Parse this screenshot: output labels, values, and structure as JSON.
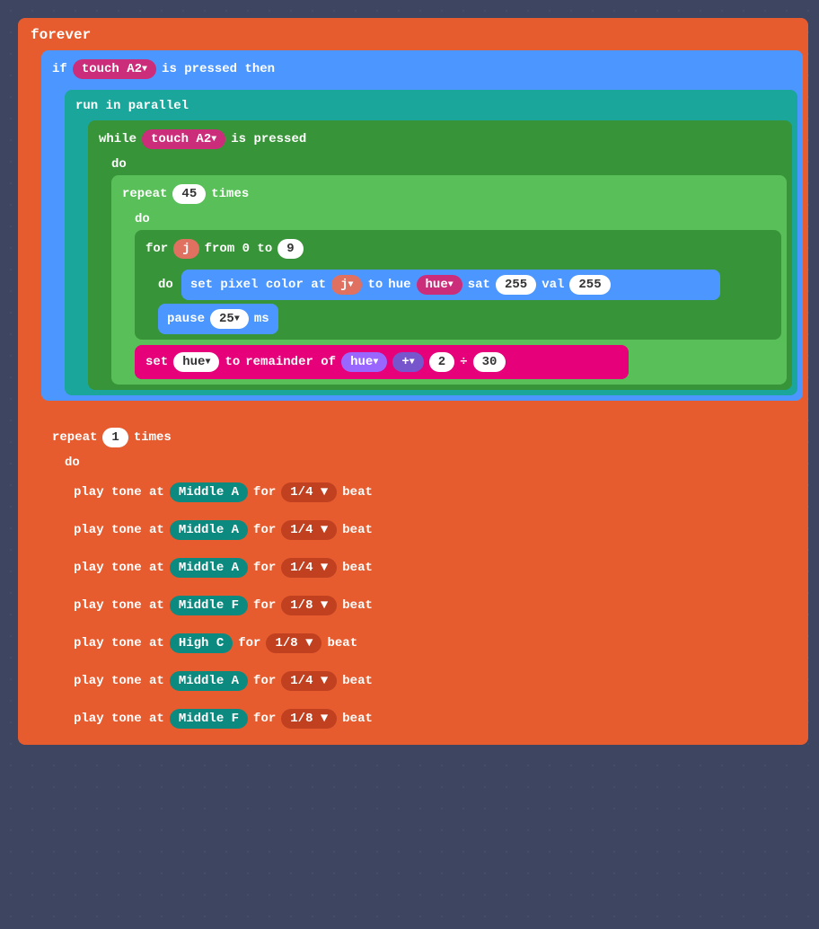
{
  "forever": {
    "label": "forever"
  },
  "if_block": {
    "label": "if",
    "condition_pill": "touch A2",
    "middle": "is pressed then"
  },
  "run_in_parallel": {
    "label": "run in parallel"
  },
  "while_block": {
    "label": "while",
    "condition_pill": "touch A2",
    "middle": "is pressed"
  },
  "do_label": "do",
  "repeat_inner": {
    "label": "repeat",
    "count": "45",
    "suffix": "times"
  },
  "for_block": {
    "label": "for",
    "var_pill": "j",
    "from_text": "from 0 to",
    "to_value": "9"
  },
  "set_pixel": {
    "label": "set pixel color at",
    "var_pill": "j",
    "to": "to",
    "hue_text": "hue",
    "hue_pill": "hue",
    "sat_text": "sat",
    "sat_value": "255",
    "val_text": "val",
    "val_value": "255"
  },
  "pause_block": {
    "label": "pause",
    "value": "25",
    "suffix": "ms"
  },
  "set_hue": {
    "label": "set",
    "var_pill": "hue",
    "to": "to",
    "remainder_text": "remainder of",
    "hue_pill": "hue",
    "plus_pill": "+",
    "add_value": "2",
    "div_symbol": "÷",
    "div_value": "30"
  },
  "repeat_outer": {
    "label": "repeat",
    "count": "1",
    "suffix": "times"
  },
  "play_tones": [
    {
      "prefix": "play tone at",
      "note_pill": "Middle A",
      "for_text": "for",
      "duration_pill": "1/4",
      "beat": "beat"
    },
    {
      "prefix": "play tone at",
      "note_pill": "Middle A",
      "for_text": "for",
      "duration_pill": "1/4",
      "beat": "beat"
    },
    {
      "prefix": "play tone at",
      "note_pill": "Middle A",
      "for_text": "for",
      "duration_pill": "1/4",
      "beat": "beat"
    },
    {
      "prefix": "play tone at",
      "note_pill": "Middle F",
      "for_text": "for",
      "duration_pill": "1/8",
      "beat": "beat"
    },
    {
      "prefix": "play tone at",
      "note_pill": "High C",
      "for_text": "for",
      "duration_pill": "1/8",
      "beat": "beat"
    },
    {
      "prefix": "play tone at",
      "note_pill": "Middle A",
      "for_text": "for",
      "duration_pill": "1/4",
      "beat": "beat"
    },
    {
      "prefix": "play tone at",
      "note_pill": "Middle F",
      "for_text": "for",
      "duration_pill": "1/8",
      "beat": "beat"
    }
  ]
}
